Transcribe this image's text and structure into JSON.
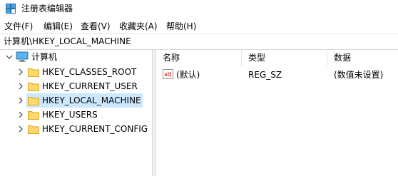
{
  "window": {
    "title": "注册表编辑器"
  },
  "menu": [
    {
      "label": "文件(F)"
    },
    {
      "label": "编辑(E)"
    },
    {
      "label": "查看(V)"
    },
    {
      "label": "收藏夹(A)"
    },
    {
      "label": "帮助(H)"
    }
  ],
  "address": {
    "path": "计算机\\HKEY_LOCAL_MACHINE"
  },
  "tree": {
    "root": {
      "label": "计算机",
      "icon": "computer-icon"
    },
    "items": [
      {
        "label": "HKEY_CLASSES_ROOT",
        "icon": "folder-icon"
      },
      {
        "label": "HKEY_CURRENT_USER",
        "icon": "folder-icon"
      },
      {
        "label": "HKEY_LOCAL_MACHINE",
        "icon": "folder-icon",
        "selected": true
      },
      {
        "label": "HKEY_USERS",
        "icon": "folder-icon"
      },
      {
        "label": "HKEY_CURRENT_CONFIG",
        "icon": "folder-icon"
      }
    ]
  },
  "list": {
    "columns": [
      "名称",
      "类型",
      "数据"
    ],
    "rows": [
      {
        "name": "(默认)",
        "type": "REG_SZ",
        "data": "(数值未设置)",
        "icon": "reg-string-icon"
      }
    ]
  },
  "colors": {
    "selection": "#cce8ff",
    "folder": "#ffd96b",
    "icon_red": "#c42b1c"
  }
}
